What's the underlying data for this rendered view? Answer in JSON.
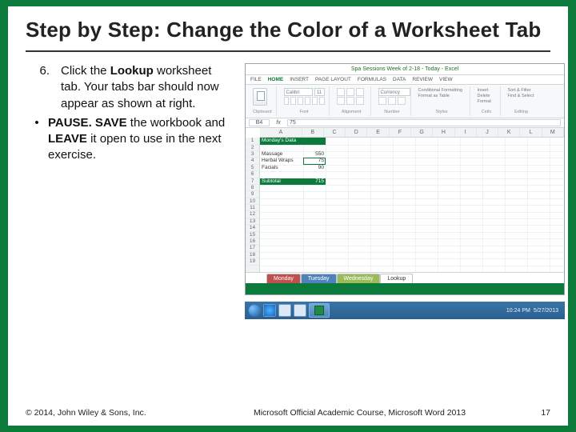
{
  "title": "Step by Step: Change the Color of a Worksheet Tab",
  "step": {
    "number": "6.",
    "pre": "Click the ",
    "bold": "Lookup",
    "post": " worksheet tab. Your tabs bar should now appear as shown at right."
  },
  "bullet": {
    "mark": "•",
    "p1": "PAUSE. SAVE",
    "p2": " the workbook and ",
    "p3": "LEAVE",
    "p4": " it open to use in the next exercise."
  },
  "excel": {
    "title": "Spa Sessions Week of 2-18 - Today - Excel",
    "ribbon_tabs": [
      "FILE",
      "HOME",
      "INSERT",
      "PAGE LAYOUT",
      "FORMULAS",
      "DATA",
      "REVIEW",
      "VIEW"
    ],
    "groups": {
      "clipboard": "Clipboard",
      "font": "Font",
      "alignment": "Alignment",
      "number": "Number",
      "styles": "Styles",
      "cells": "Cells",
      "editing": "Editing"
    },
    "font_name": "Calibri",
    "font_size": "11",
    "number_format": "Currency",
    "styles_item1": "Conditional Formatting",
    "styles_item2": "Format as Table",
    "cells_item1": "Insert",
    "cells_item2": "Delete",
    "cells_item3": "Format",
    "editing_item1": "Sort & Filter",
    "editing_item2": "Find & Select",
    "namebox": "B4",
    "fbar_value": "75",
    "columns": [
      "A",
      "B",
      "C",
      "D",
      "E",
      "F",
      "G",
      "H",
      "I",
      "J",
      "K",
      "L",
      "M"
    ],
    "rows": [
      "1",
      "2",
      "3",
      "4",
      "5",
      "6",
      "7",
      "8",
      "9",
      "10",
      "11",
      "12",
      "13",
      "14",
      "15",
      "16",
      "17",
      "18",
      "19"
    ],
    "data": {
      "a1": "Monday's Data",
      "a3": "Massage",
      "b3": "550",
      "a4": "Herbal Wraps",
      "b4": "75",
      "a5": "Facials",
      "b5": "90",
      "a7": "Subtotal",
      "b7": "715"
    },
    "tabs": [
      {
        "label": "Monday",
        "color": "#c0504d"
      },
      {
        "label": "Tuesday",
        "color": "#4f81bd"
      },
      {
        "label": "Wednesday",
        "color": "#9bbb59"
      },
      {
        "label": "Lookup",
        "color": "#ffffff"
      }
    ],
    "clock": {
      "time": "10:24 PM",
      "date": "5/27/2013"
    }
  },
  "footer": {
    "left": "© 2014, John Wiley & Sons, Inc.",
    "center": "Microsoft Official Academic Course, Microsoft Word 2013",
    "page": "17"
  }
}
